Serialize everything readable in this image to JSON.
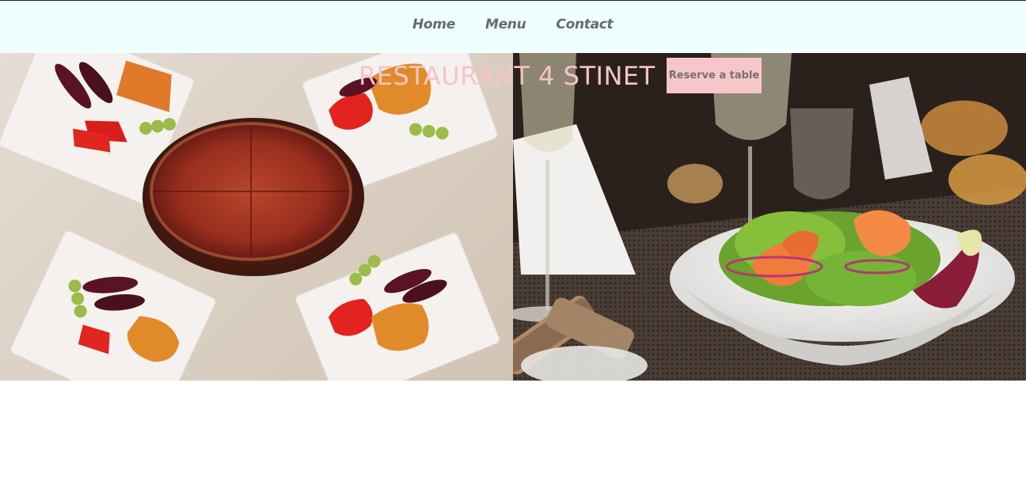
{
  "nav": {
    "items": [
      {
        "label": "Home"
      },
      {
        "label": "Menu"
      },
      {
        "label": "Contact"
      }
    ]
  },
  "hero": {
    "title": "RESTAURANT 4 STINET",
    "reserve_label": "Reserve a table",
    "left_image": "plated pizza and vegetables on white table",
    "right_image": "shrimp salad bowl with wine glasses on dark table"
  },
  "colors": {
    "nav_background": "#eefffd",
    "nav_text": "#666a6e",
    "brand_text": "#f6c4c8",
    "button_background": "#f7c6ca",
    "button_text": "#737070"
  }
}
